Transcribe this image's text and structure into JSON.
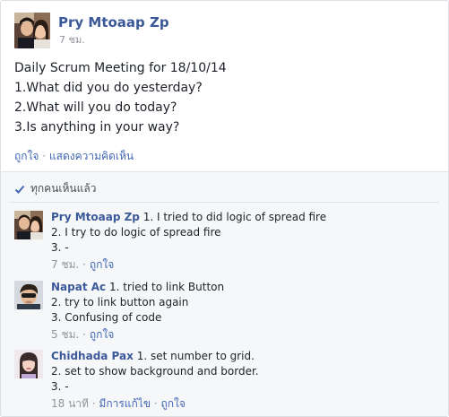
{
  "post": {
    "author": "Pry Mtoaap Zp",
    "timestamp": "7 ชม.",
    "lines": [
      "Daily Scrum Meeting for 18/10/14",
      "1.What did you do yesterday?",
      "2.What will you do today?",
      "3.Is anything in your way?"
    ],
    "like_label": "ถูกใจ",
    "separator": "·",
    "comment_label": "แสดงความคิดเห็น"
  },
  "seen": {
    "icon": "check-icon",
    "label": "ทุกคนเห็นแล้ว"
  },
  "comments": [
    {
      "author": "Pry Mtoaap Zp",
      "first_line": "1. I tried to did logic of spread fire",
      "line2": "2. I try to do logic of spread fire",
      "line3": "3. -",
      "timestamp": "7 ชม.",
      "like_label": "ถูกใจ"
    },
    {
      "author": "Napat Ac",
      "first_line": "1. tried to link Button",
      "line2": "2. try to link button again",
      "line3": "3. Confusing of code",
      "timestamp": "5 ชม.",
      "like_label": "ถูกใจ"
    },
    {
      "author": "Chidhada Pax",
      "first_line": "1. set number to grid.",
      "line2": "2. set to show background and border.",
      "line3": "3. -",
      "timestamp": "18 นาที",
      "edited_label": "มีการแก้ไข",
      "like_label": "ถูกใจ"
    }
  ],
  "colors": {
    "link": "#3b5998",
    "action_link": "#4267b2",
    "meta": "#90949c",
    "ufi_background": "#f6f7f9"
  }
}
